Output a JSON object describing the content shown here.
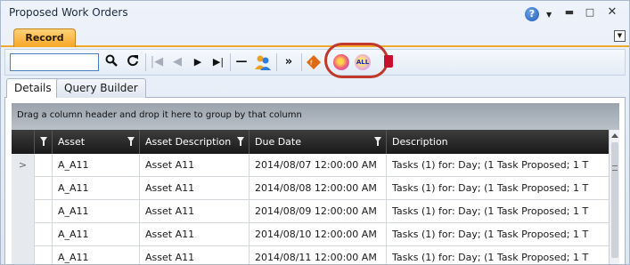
{
  "window": {
    "title": "Proposed Work Orders",
    "help_icon": "question-circle-icon",
    "controls": [
      "dropdown-arrow-icon",
      "minimize-icon",
      "maximize-icon",
      "close-icon"
    ]
  },
  "record_tab": {
    "label": "Record"
  },
  "toolbar": {
    "search_value": "",
    "icons": [
      "search-icon",
      "refresh-icon",
      "first-record-icon",
      "previous-record-icon",
      "next-record-icon",
      "last-record-icon",
      "remove-icon",
      "users-icon",
      "fast-forward-icon",
      "filter-clear-icon",
      "select-icon",
      "select-all-icon",
      "delete-icon"
    ],
    "select_all_label": "ALL",
    "highlight_color": "#c0392b"
  },
  "subtabs": [
    {
      "label": "Details"
    },
    {
      "label": "Query Builder"
    }
  ],
  "group_panel": {
    "text": "Drag a column header and drop it here to group by that column"
  },
  "grid": {
    "columns": [
      "",
      "Asset",
      "Asset Description",
      "Due Date",
      "Description"
    ],
    "rows": [
      {
        "indicator": ">",
        "asset": "A_A11",
        "asset_description": "Asset A11",
        "due_date": "2014/08/07 12:00:00 AM",
        "description": "Tasks (1) for: Day;   (1 Task Proposed; 1 T"
      },
      {
        "indicator": "",
        "asset": "A_A11",
        "asset_description": "Asset A11",
        "due_date": "2014/08/08 12:00:00 AM",
        "description": "Tasks (1) for: Day;   (1 Task Proposed; 1 T"
      },
      {
        "indicator": "",
        "asset": "A_A11",
        "asset_description": "Asset A11",
        "due_date": "2014/08/09 12:00:00 AM",
        "description": "Tasks (1) for: Day;   (1 Task Proposed; 1 T"
      },
      {
        "indicator": "",
        "asset": "A_A11",
        "asset_description": "Asset A11",
        "due_date": "2014/08/10 12:00:00 AM",
        "description": "Tasks (1) for: Day;   (1 Task Proposed; 1 T"
      },
      {
        "indicator": "",
        "asset": "A_A11",
        "asset_description": "Asset A11",
        "due_date": "2014/08/11 12:00:00 AM",
        "description": "Tasks (1) for: Day;   (1 Task Proposed; 1 T"
      }
    ]
  }
}
